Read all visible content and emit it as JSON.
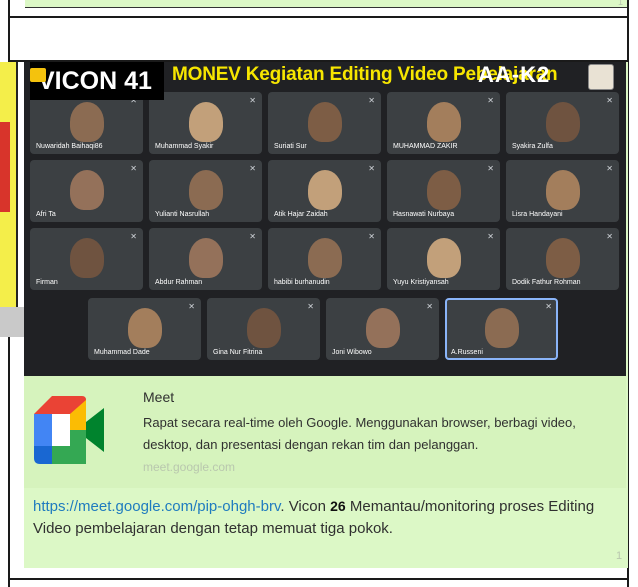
{
  "meeting": {
    "vicon_label": "VICON 41",
    "title": "MONEV  Kegiatan Editing Video Pebelajaran",
    "code": "AA-K2",
    "participants": [
      "Nuwaridah Baihaqi86",
      "Muhammad Syakir",
      "Suriati Sur",
      "MUHAMMAD ZAKIR",
      "Syakira Zulfa",
      "Afri Ta",
      "Yulianti Nasrullah",
      "Atik Hajar Zaidah",
      "Hasnawati Nurbaya",
      "Lisra Handayani",
      "Firman",
      "Abdur Rahman",
      "habibi burhanudin",
      "Yuyu Kristiyansah",
      "Dodik Fathur Rohman",
      "Muhammad Dade",
      "Gina Nur Fitrina",
      "Joni Wibowo",
      "A.Russeni"
    ]
  },
  "link_preview": {
    "title": "Meet",
    "description": "Rapat secara real-time oleh Google. Menggunakan browser, berbagi video, desktop, dan presentasi dengan rekan tim dan pelanggan.",
    "domain": "meet.google.com"
  },
  "message": {
    "url": "https://meet.google.com/pip-ohgh-brv",
    "text_before_num": ". Vicon ",
    "number": "26",
    "text_after_num": " Memantau/monitoring proses Editing Video pembelajaran dengan tetap memuat tiga pokok.",
    "time": "1"
  },
  "top_time": "1"
}
